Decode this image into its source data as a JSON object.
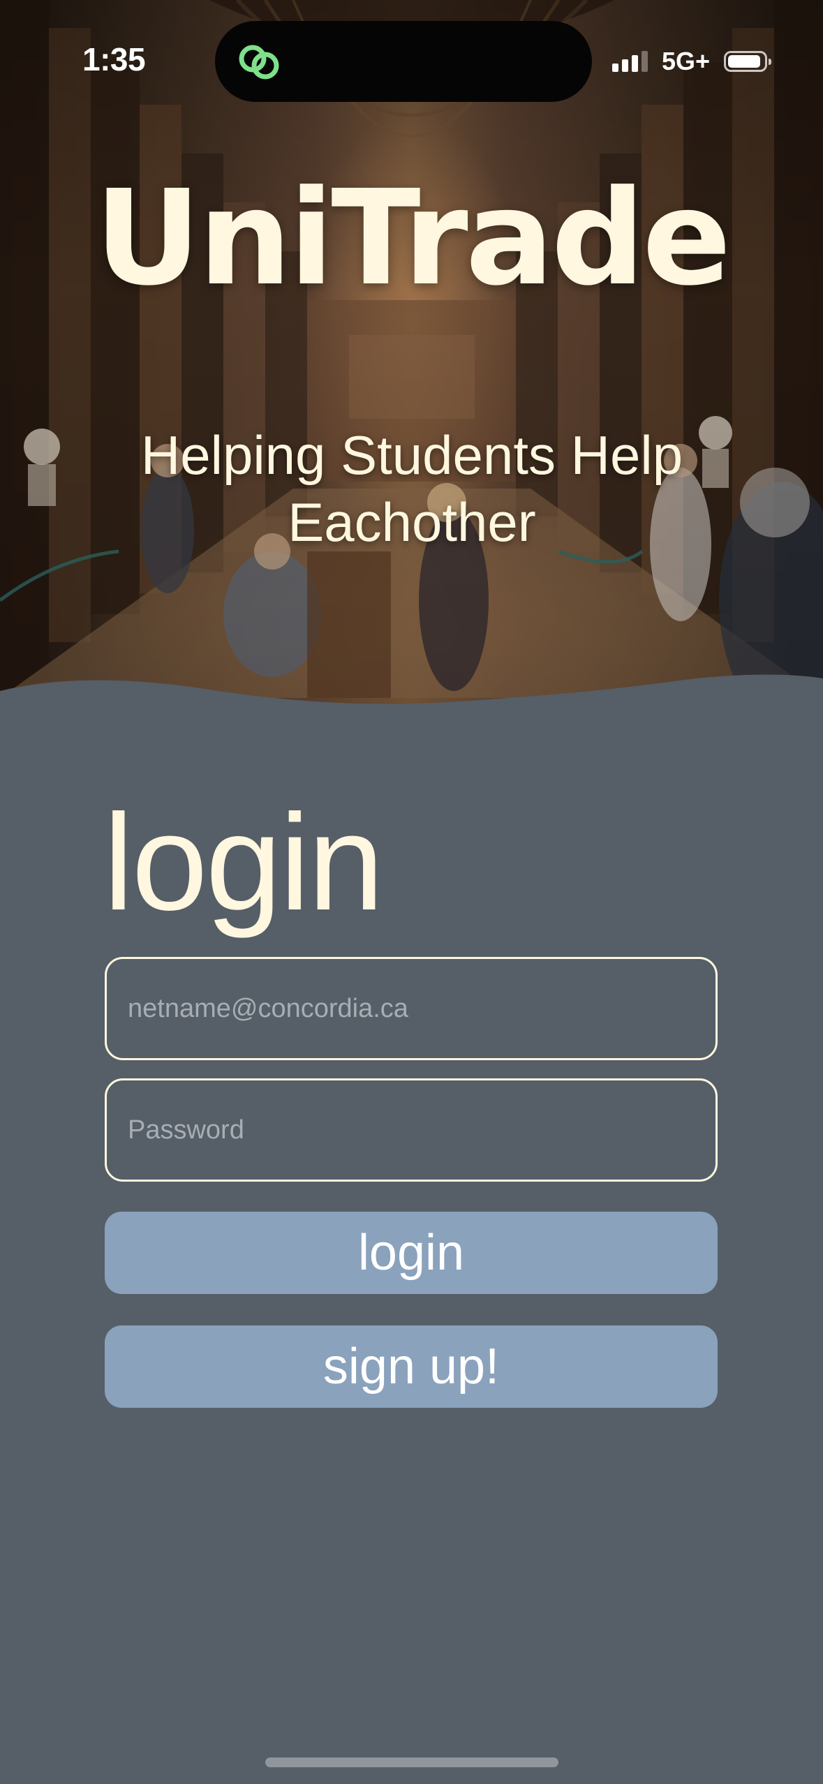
{
  "status_bar": {
    "time": "1:35",
    "network": "5G+",
    "signal_bars_active": 3,
    "signal_bars_total": 4,
    "battery_level": 0.85,
    "island_icon": "link-rings-icon"
  },
  "hero": {
    "title": "UniTrade",
    "tagline": "Helping Students Help Eachother",
    "background": "library-hall-photo"
  },
  "login": {
    "heading": "login",
    "email_placeholder": "netname@concordia.ca",
    "password_placeholder": "Password",
    "login_button": "login",
    "signup_button": "sign up!"
  },
  "colors": {
    "background": "#565e67",
    "text_cream": "#fff7df",
    "button": "#8aa2bc",
    "placeholder": "#a7adb3",
    "island_icon": "#7fe08a"
  }
}
